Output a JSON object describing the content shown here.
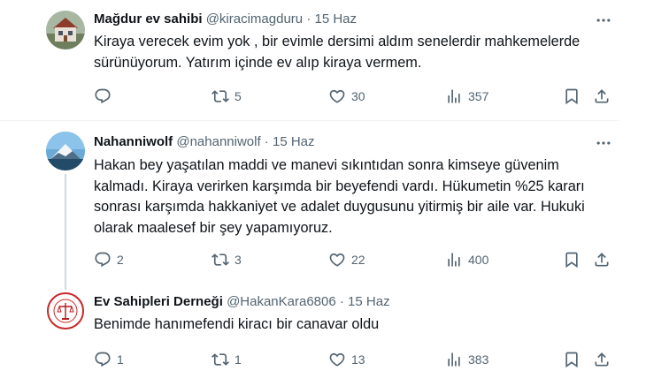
{
  "tweets": [
    {
      "name": "Mağdur ev sahibi",
      "handle": "@kiracimagduru",
      "separator": "·",
      "date": "15 Haz",
      "text": "Kiraya verecek evim yok , bir evimle dersimi aldım senelerdir mahkemelerde sürünüyorum. Yatırım içinde ev alıp kiraya vermem.",
      "replies": "",
      "retweets": "5",
      "likes": "30",
      "views": "357"
    },
    {
      "name": "Nahanniwolf",
      "handle": "@nahanniwolf",
      "separator": "·",
      "date": "15 Haz",
      "text": "Hakan bey yaşatılan maddi ve manevi sıkıntıdan sonra kimseye güvenim kalmadı. Kiraya verirken karşımda bir beyefendi vardı. Hükumetin %25 kararı sonrası karşımda hakkaniyet ve adalet duygusunu yitirmiş bir aile var. Hukuki olarak maalesef bir şey yapamıyoruz.",
      "replies": "2",
      "retweets": "3",
      "likes": "22",
      "views": "400"
    },
    {
      "name": "Ev Sahipleri Derneği",
      "handle": "@HakanKara6806",
      "separator": "·",
      "date": "15 Haz",
      "text": "Benimde hanımefendi kiracı bir canavar oldu",
      "replies": "1",
      "retweets": "1",
      "likes": "13",
      "views": "383"
    }
  ],
  "colors": {
    "text": "#0f1419",
    "secondary": "#536471",
    "divider": "#eff3f4",
    "thread_line": "#cfd9de"
  },
  "icons": [
    "reply-icon",
    "retweet-icon",
    "like-icon",
    "views-icon",
    "bookmark-icon",
    "share-icon",
    "more-icon"
  ]
}
